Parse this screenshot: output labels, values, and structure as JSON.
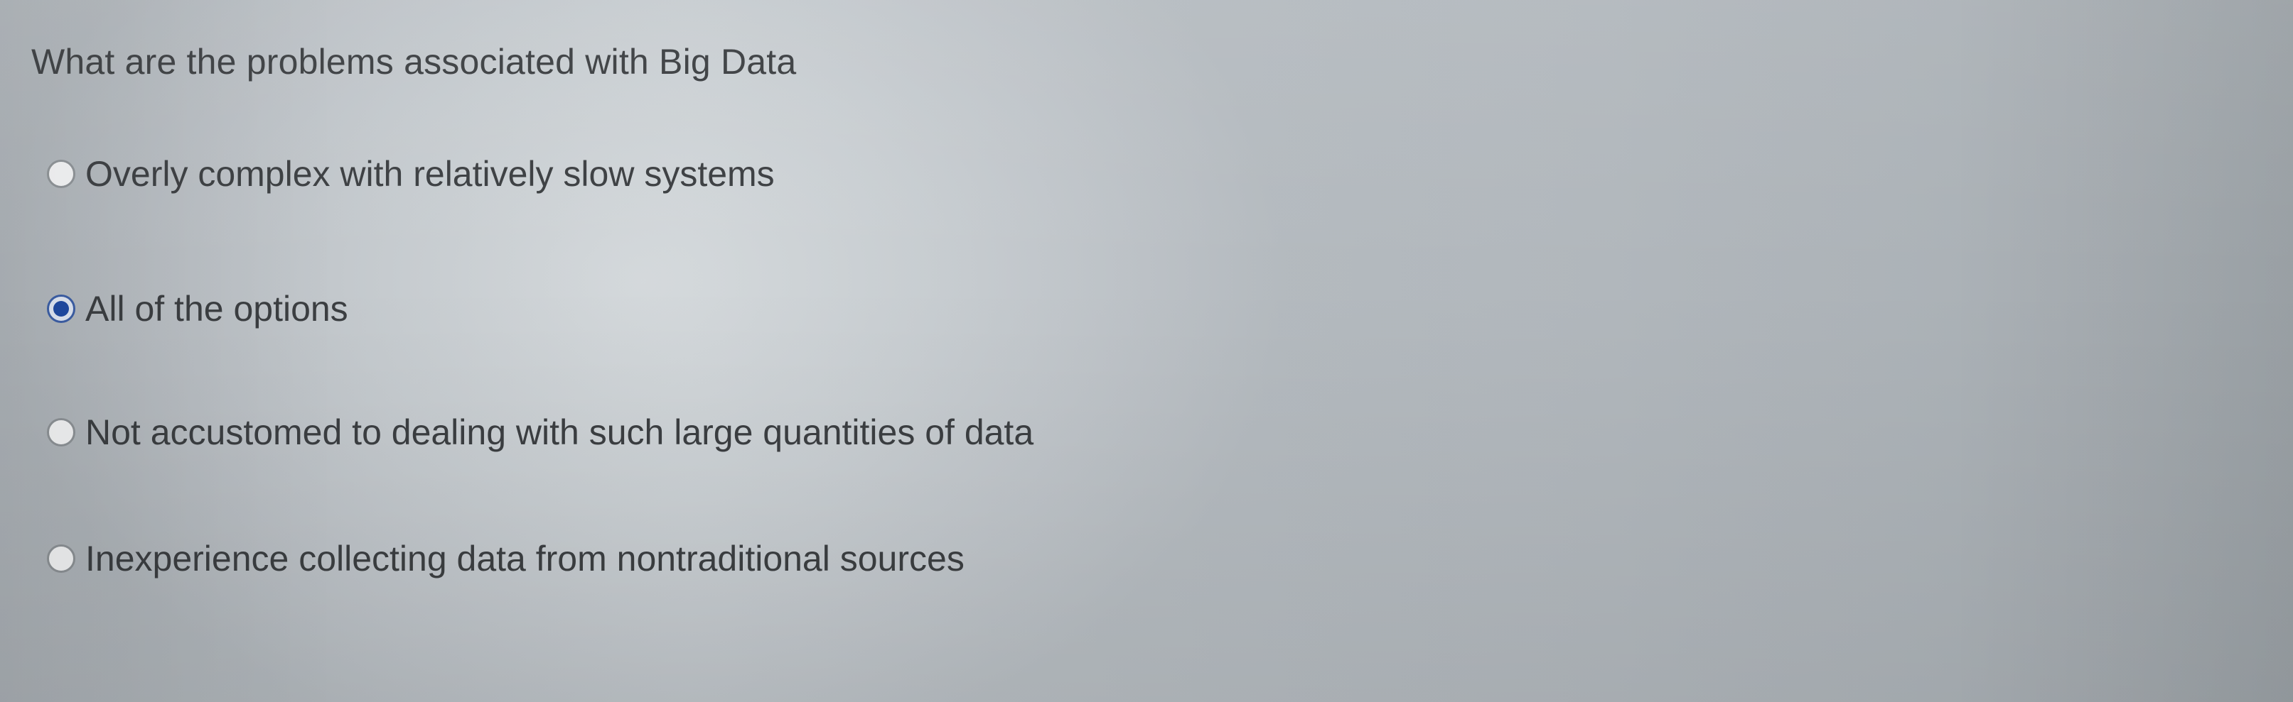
{
  "question": {
    "text": "What are the problems associated with Big Data"
  },
  "options": [
    {
      "label": "Overly complex with relatively slow systems",
      "selected": false
    },
    {
      "label": "All of the options",
      "selected": true
    },
    {
      "label": "Not accustomed to dealing with such large quantities of data",
      "selected": false
    },
    {
      "label": "Inexperience collecting data from nontraditional sources",
      "selected": false
    }
  ],
  "colors": {
    "selected_radio": "#1f4aa3",
    "text": "#3b3e41"
  }
}
